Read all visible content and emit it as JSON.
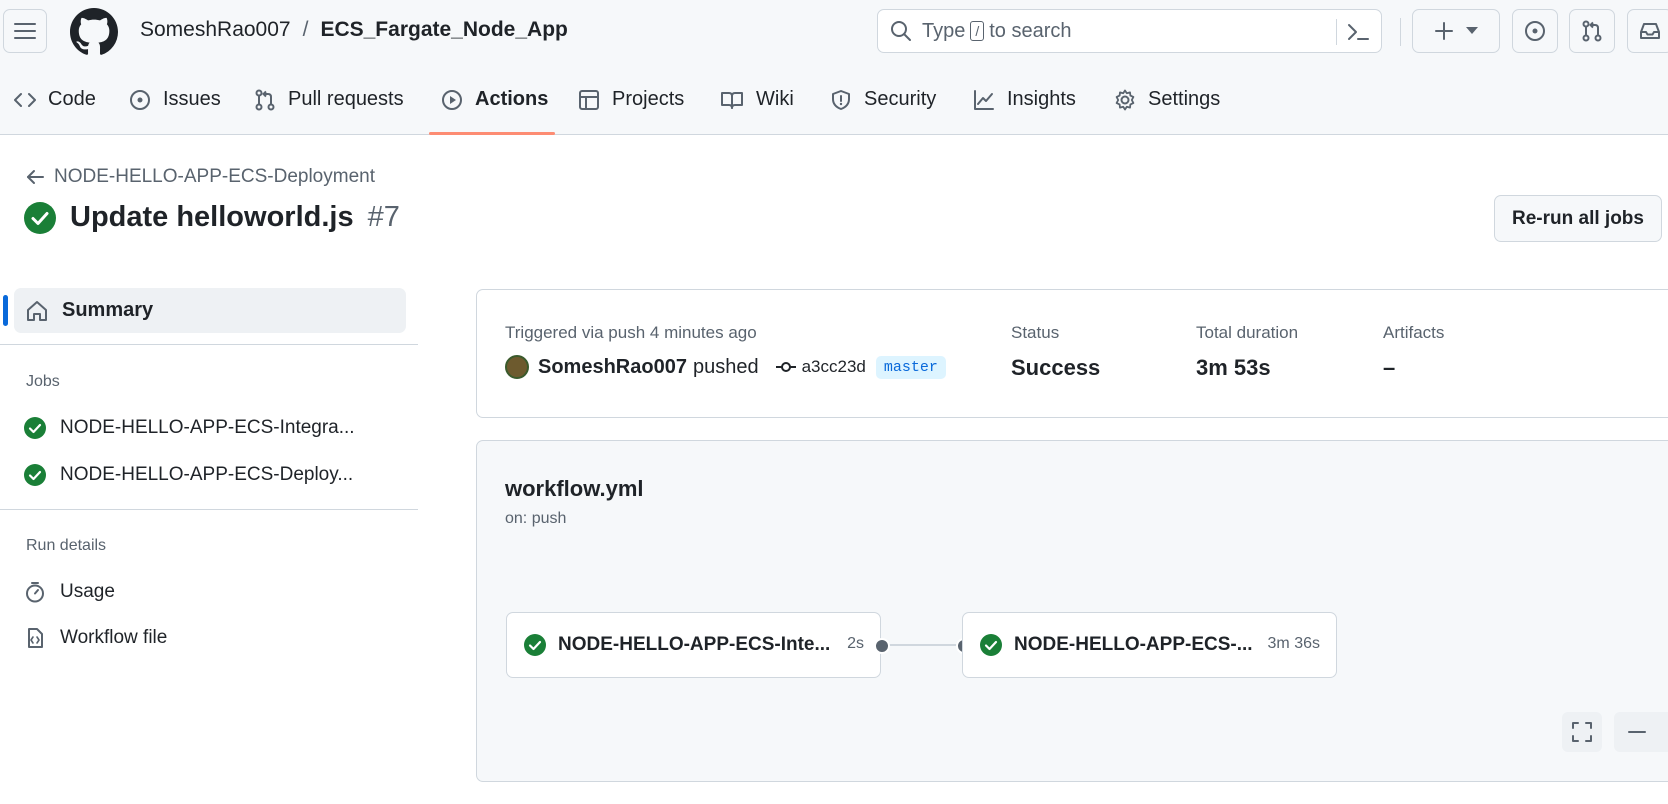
{
  "header": {
    "owner": "SomeshRao007",
    "separator": "/",
    "repo": "ECS_Fargate_Node_App",
    "search": {
      "prefix": "Type",
      "key": "/",
      "suffix": "to search"
    }
  },
  "nav": {
    "tabs": [
      {
        "label": "Code",
        "icon": "code-icon"
      },
      {
        "label": "Issues",
        "icon": "issue-opened-icon"
      },
      {
        "label": "Pull requests",
        "icon": "git-pull-request-icon"
      },
      {
        "label": "Actions",
        "icon": "play-icon",
        "active": true
      },
      {
        "label": "Projects",
        "icon": "table-icon"
      },
      {
        "label": "Wiki",
        "icon": "book-icon"
      },
      {
        "label": "Security",
        "icon": "shield-icon"
      },
      {
        "label": "Insights",
        "icon": "graph-icon"
      },
      {
        "label": "Settings",
        "icon": "gear-icon"
      }
    ]
  },
  "run": {
    "workflow_link": "NODE-HELLO-APP-ECS-Deployment",
    "title": "Update helloworld.js",
    "number": "#7",
    "rerun_label": "Re-run all jobs"
  },
  "sidebar": {
    "summary_label": "Summary",
    "jobs_heading": "Jobs",
    "jobs": [
      {
        "label": "NODE-HELLO-APP-ECS-Integra..."
      },
      {
        "label": "NODE-HELLO-APP-ECS-Deploy..."
      }
    ],
    "run_details_heading": "Run details",
    "details": [
      {
        "label": "Usage"
      },
      {
        "label": "Workflow file"
      }
    ]
  },
  "summary": {
    "triggered_label": "Triggered via push 4 minutes ago",
    "user": "SomeshRao007",
    "action": "pushed",
    "commit": "a3cc23d",
    "branch": "master",
    "status_label": "Status",
    "status_value": "Success",
    "duration_label": "Total duration",
    "duration_value": "3m 53s",
    "artifacts_label": "Artifacts",
    "artifacts_value": "–"
  },
  "workflow": {
    "file": "workflow.yml",
    "trigger": "on: push",
    "jobs": [
      {
        "name": "NODE-HELLO-APP-ECS-Inte...",
        "duration": "2s"
      },
      {
        "name": "NODE-HELLO-APP-ECS-...",
        "duration": "3m 36s"
      }
    ]
  },
  "colors": {
    "success": "#1a7f37",
    "accent": "#0969da",
    "tab_underline": "#fd8c73"
  }
}
